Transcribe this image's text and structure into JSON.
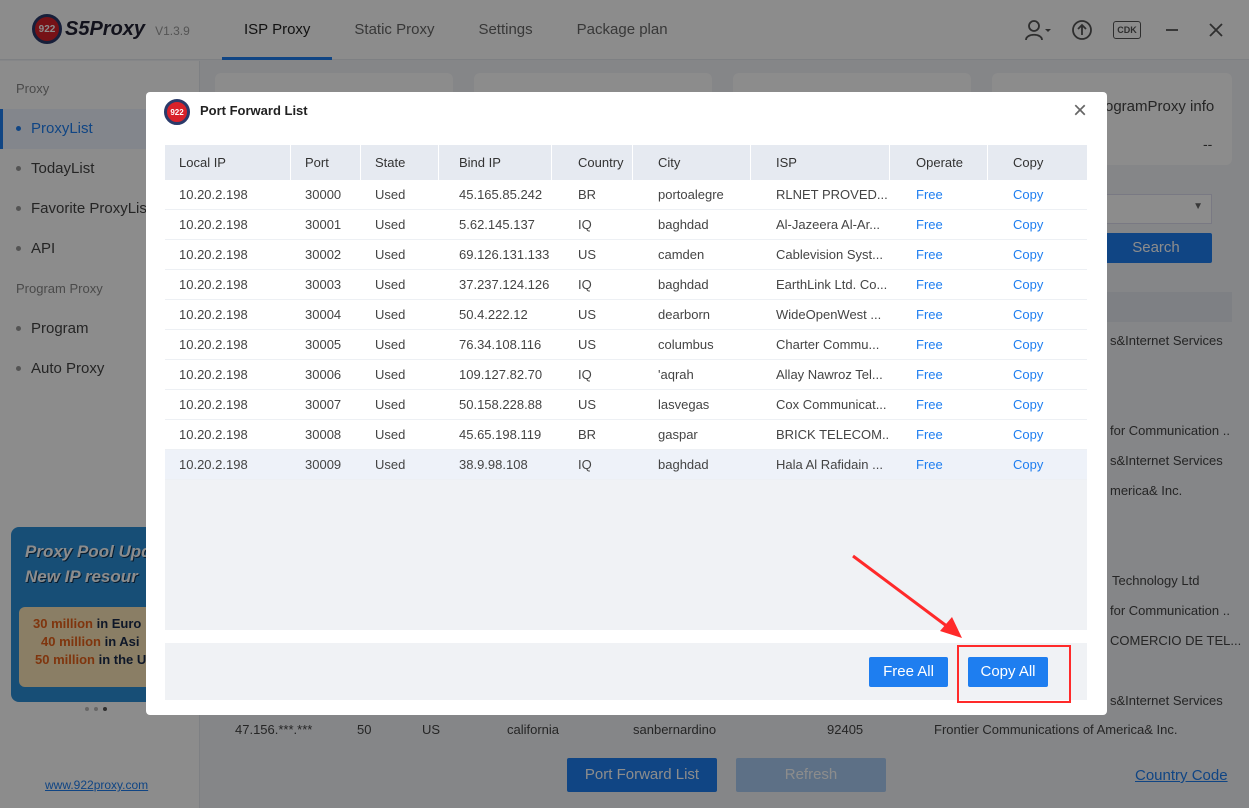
{
  "app": {
    "name_prefix": "922",
    "name": "S5Proxy",
    "version": "V1.3.9"
  },
  "nav": {
    "tabs": [
      "ISP Proxy",
      "Static Proxy",
      "Settings",
      "Package plan"
    ],
    "active": "ISP Proxy"
  },
  "top_icons": {
    "cdk": "CDK"
  },
  "sidebar": {
    "section_proxy": "Proxy",
    "items_proxy": [
      "ProxyList",
      "TodayList",
      "Favorite ProxyList",
      "API"
    ],
    "section_program": "Program Proxy",
    "items_program": [
      "Program",
      "Auto Proxy"
    ],
    "promo": {
      "title1": "Proxy Pool Upd",
      "title2": "New IP resour",
      "line1_num": "30 million",
      "line1_rest": " in Euro",
      "line2_num": "40 million",
      "line2_rest": " in Asi",
      "line3_num": "50 million",
      "line3_rest": " in the US"
    },
    "site": "www.922proxy.com"
  },
  "background": {
    "program_proxy_info": "ogramProxy info",
    "dashes": "--",
    "search": "Search",
    "isp_frag": [
      "s&Internet Services",
      "for Communication ..",
      "s&Internet Services",
      "merica& Inc.",
      "Technology Ltd",
      "for Communication ..",
      "COMERCIO DE TEL...",
      "s&Internet Services"
    ],
    "row": {
      "ip": "47.156.***.***",
      "num": "50",
      "country": "US",
      "state": "california",
      "city": "sanbernardino",
      "zip": "92405",
      "isp": "Frontier Communications of America& Inc."
    },
    "port_forward_list": "Port Forward List",
    "refresh": "Refresh",
    "country_code": "Country Code"
  },
  "modal": {
    "logo": "922",
    "title": "Port Forward List",
    "columns": [
      "Local IP",
      "Port",
      "State",
      "Bind IP",
      "Country",
      "City",
      "ISP",
      "Operate",
      "Copy"
    ],
    "rows": [
      [
        "10.20.2.198",
        "30000",
        "Used",
        "45.165.85.242",
        "BR",
        "portoalegre",
        "RLNET PROVED...",
        "Free",
        "Copy"
      ],
      [
        "10.20.2.198",
        "30001",
        "Used",
        "5.62.145.137",
        "IQ",
        "baghdad",
        "Al-Jazeera Al-Ar...",
        "Free",
        "Copy"
      ],
      [
        "10.20.2.198",
        "30002",
        "Used",
        "69.126.131.133",
        "US",
        "camden",
        "Cablevision Syst...",
        "Free",
        "Copy"
      ],
      [
        "10.20.2.198",
        "30003",
        "Used",
        "37.237.124.126",
        "IQ",
        "baghdad",
        "EarthLink Ltd. Co...",
        "Free",
        "Copy"
      ],
      [
        "10.20.2.198",
        "30004",
        "Used",
        "50.4.222.12",
        "US",
        "dearborn",
        "WideOpenWest ...",
        "Free",
        "Copy"
      ],
      [
        "10.20.2.198",
        "30005",
        "Used",
        "76.34.108.116",
        "US",
        "columbus",
        "Charter Commu...",
        "Free",
        "Copy"
      ],
      [
        "10.20.2.198",
        "30006",
        "Used",
        "109.127.82.70",
        "IQ",
        "'aqrah",
        "Allay Nawroz Tel...",
        "Free",
        "Copy"
      ],
      [
        "10.20.2.198",
        "30007",
        "Used",
        "50.158.228.88",
        "US",
        "lasvegas",
        "Cox Communicat...",
        "Free",
        "Copy"
      ],
      [
        "10.20.2.198",
        "30008",
        "Used",
        "45.65.198.119",
        "BR",
        "gaspar",
        "BRICK TELECOM...",
        "Free",
        "Copy"
      ],
      [
        "10.20.2.198",
        "30009",
        "Used",
        "38.9.98.108",
        "IQ",
        "baghdad",
        "Hala Al Rafidain ...",
        "Free",
        "Copy"
      ]
    ],
    "free_all": "Free All",
    "copy_all": "Copy All"
  },
  "colors": {
    "accent": "#1e7ef0",
    "highlight": "#ff2a2a",
    "logo_red": "#d8222a"
  }
}
